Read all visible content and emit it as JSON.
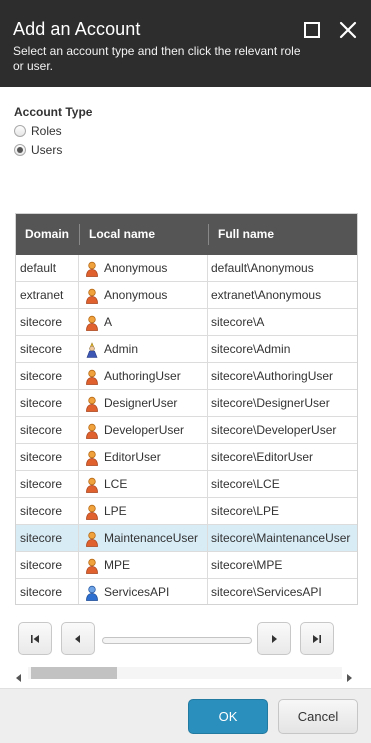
{
  "dialog": {
    "title": "Add an Account",
    "subtitle": "Select an account type and then click the relevant role or user."
  },
  "account_type": {
    "label": "Account Type",
    "options": [
      {
        "label": "Roles",
        "checked": false
      },
      {
        "label": "Users",
        "checked": true
      }
    ]
  },
  "grid": {
    "columns": [
      "Domain",
      "Local name",
      "Full name"
    ],
    "rows": [
      {
        "domain": "default",
        "local": "Anonymous",
        "full": "default\\Anonymous",
        "icon": "user-icon"
      },
      {
        "domain": "extranet",
        "local": "Anonymous",
        "full": "extranet\\Anonymous",
        "icon": "user-icon"
      },
      {
        "domain": "sitecore",
        "local": "A",
        "full": "sitecore\\A",
        "icon": "user-icon"
      },
      {
        "domain": "sitecore",
        "local": "Admin",
        "full": "sitecore\\Admin",
        "icon": "admin-user-icon"
      },
      {
        "domain": "sitecore",
        "local": "AuthoringUser",
        "full": "sitecore\\AuthoringUser",
        "icon": "user-icon"
      },
      {
        "domain": "sitecore",
        "local": "DesignerUser",
        "full": "sitecore\\DesignerUser",
        "icon": "user-icon"
      },
      {
        "domain": "sitecore",
        "local": "DeveloperUser",
        "full": "sitecore\\DeveloperUser",
        "icon": "user-icon"
      },
      {
        "domain": "sitecore",
        "local": "EditorUser",
        "full": "sitecore\\EditorUser",
        "icon": "user-icon"
      },
      {
        "domain": "sitecore",
        "local": "LCE",
        "full": "sitecore\\LCE",
        "icon": "user-icon"
      },
      {
        "domain": "sitecore",
        "local": "LPE",
        "full": "sitecore\\LPE",
        "icon": "user-icon"
      },
      {
        "domain": "sitecore",
        "local": "MaintenanceUser",
        "full": "sitecore\\MaintenanceUser",
        "icon": "user-icon",
        "selected": true
      },
      {
        "domain": "sitecore",
        "local": "MPE",
        "full": "sitecore\\MPE",
        "icon": "user-icon"
      },
      {
        "domain": "sitecore",
        "local": "ServicesAPI",
        "full": "sitecore\\ServicesAPI",
        "icon": "service-user-icon"
      }
    ]
  },
  "pager": {
    "icons": [
      "first-page-icon",
      "previous-page-icon",
      "next-page-icon",
      "last-page-icon"
    ]
  },
  "footer": {
    "ok_label": "OK",
    "cancel_label": "Cancel"
  },
  "colors": {
    "header_bg": "#2d2d2d",
    "grid_header_bg": "#555555",
    "selected_row_bg": "#d8ecf6",
    "ok_button_bg": "#2a8fbd"
  }
}
